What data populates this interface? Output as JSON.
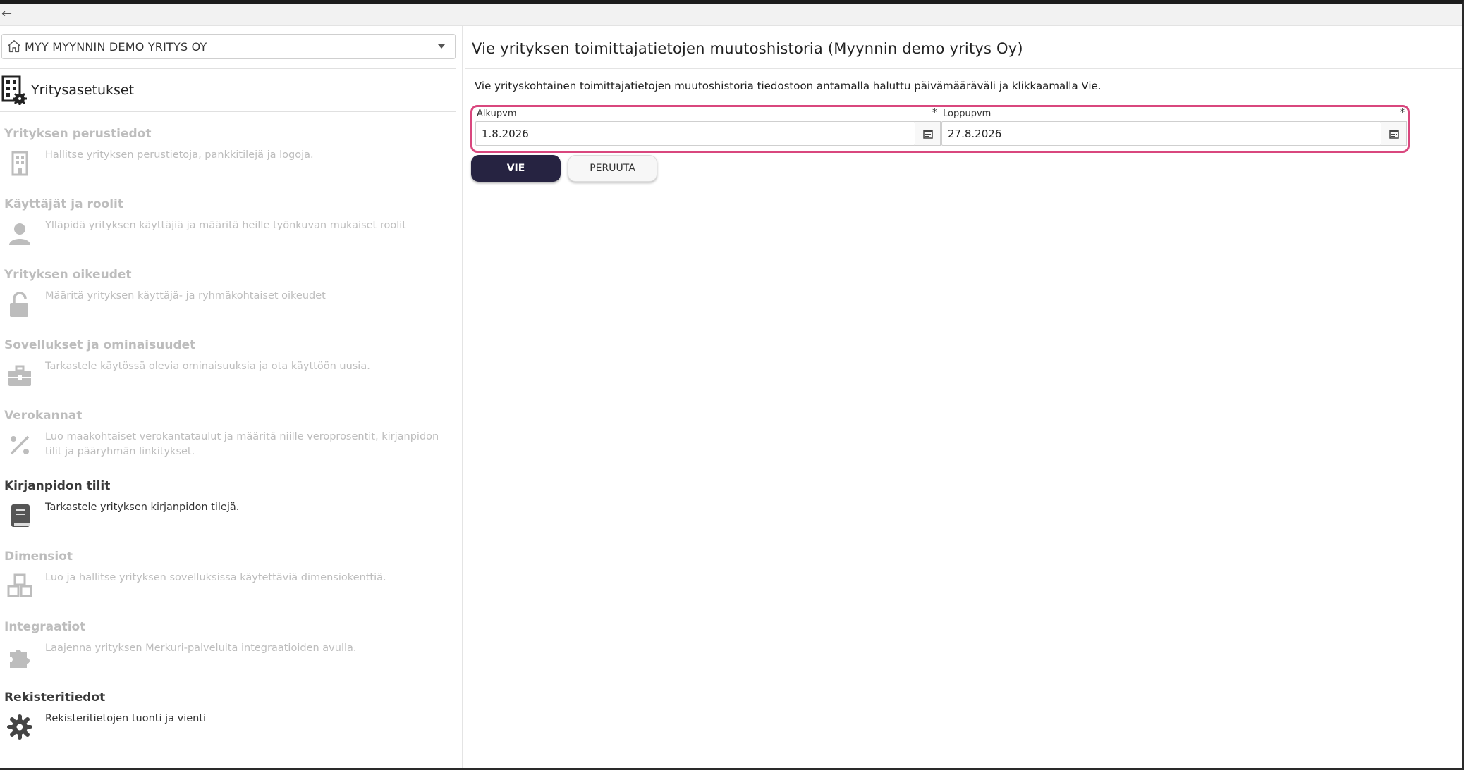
{
  "topbar": {
    "back_icon": "arrow-left-icon",
    "back_glyph": "←"
  },
  "company_select": {
    "value": "MYY MYYNNIN DEMO YRITYS OY",
    "icon": "home-icon"
  },
  "sidebar": {
    "title": "Yritysasetukset",
    "icon": "building-gear-icon",
    "sections": [
      {
        "title": "Yrityksen perustiedot",
        "desc": "Hallitse yrityksen perustietoja, pankkitilejä ja logoja.",
        "icon": "building-icon",
        "active": false
      },
      {
        "title": "Käyttäjät ja roolit",
        "desc": "Ylläpidä yrityksen käyttäjiä ja määritä heille työnkuvan mukaiset roolit",
        "icon": "user-icon",
        "active": false
      },
      {
        "title": "Yrityksen oikeudet",
        "desc": "Määritä yrityksen käyttäjä- ja ryhmäkohtaiset oikeudet",
        "icon": "unlock-icon",
        "active": false
      },
      {
        "title": "Sovellukset ja ominaisuudet",
        "desc": "Tarkastele käytössä olevia ominaisuuksia ja ota käyttöön uusia.",
        "icon": "briefcase-icon",
        "active": false
      },
      {
        "title": "Verokannat",
        "desc": "Luo maakohtaiset verokantataulut ja määritä niille veroprosentit, kirjanpidon tilit ja pääryhmän linkitykset.",
        "icon": "percent-icon",
        "active": false
      },
      {
        "title": "Kirjanpidon tilit",
        "desc": "Tarkastele yrityksen kirjanpidon tilejä.",
        "icon": "book-icon",
        "active": true
      },
      {
        "title": "Dimensiot",
        "desc": "Luo ja hallitse yrityksen sovelluksissa käytettäviä dimensiokenttiä.",
        "icon": "cubes-icon",
        "active": false
      },
      {
        "title": "Integraatiot",
        "desc": "Laajenna yrityksen Merkuri-palveluita integraatioiden avulla.",
        "icon": "puzzle-icon",
        "active": false
      },
      {
        "title": "Rekisteritiedot",
        "desc": "Rekisteritietojen tuonti ja vienti",
        "icon": "gear-icon",
        "active": true
      }
    ]
  },
  "main": {
    "title": "Vie yrityksen toimittajatietojen muutoshistoria (Myynnin demo yritys Oy)",
    "description": "Vie yrityskohtainen toimittajatietojen muutoshistoria tiedostoon antamalla haluttu päivämääräväli ja klikkaamalla Vie.",
    "start": {
      "label": "Alkupvm",
      "required": "*",
      "value": "1.8.2026"
    },
    "end": {
      "label": "Loppupvm",
      "required": "*",
      "value": "27.8.2026"
    },
    "export_label": "VIE",
    "cancel_label": "PERUUTA"
  },
  "colors": {
    "highlight": "#d9477e",
    "primary_button": "#262341",
    "muted_text": "#bdbdbd"
  }
}
